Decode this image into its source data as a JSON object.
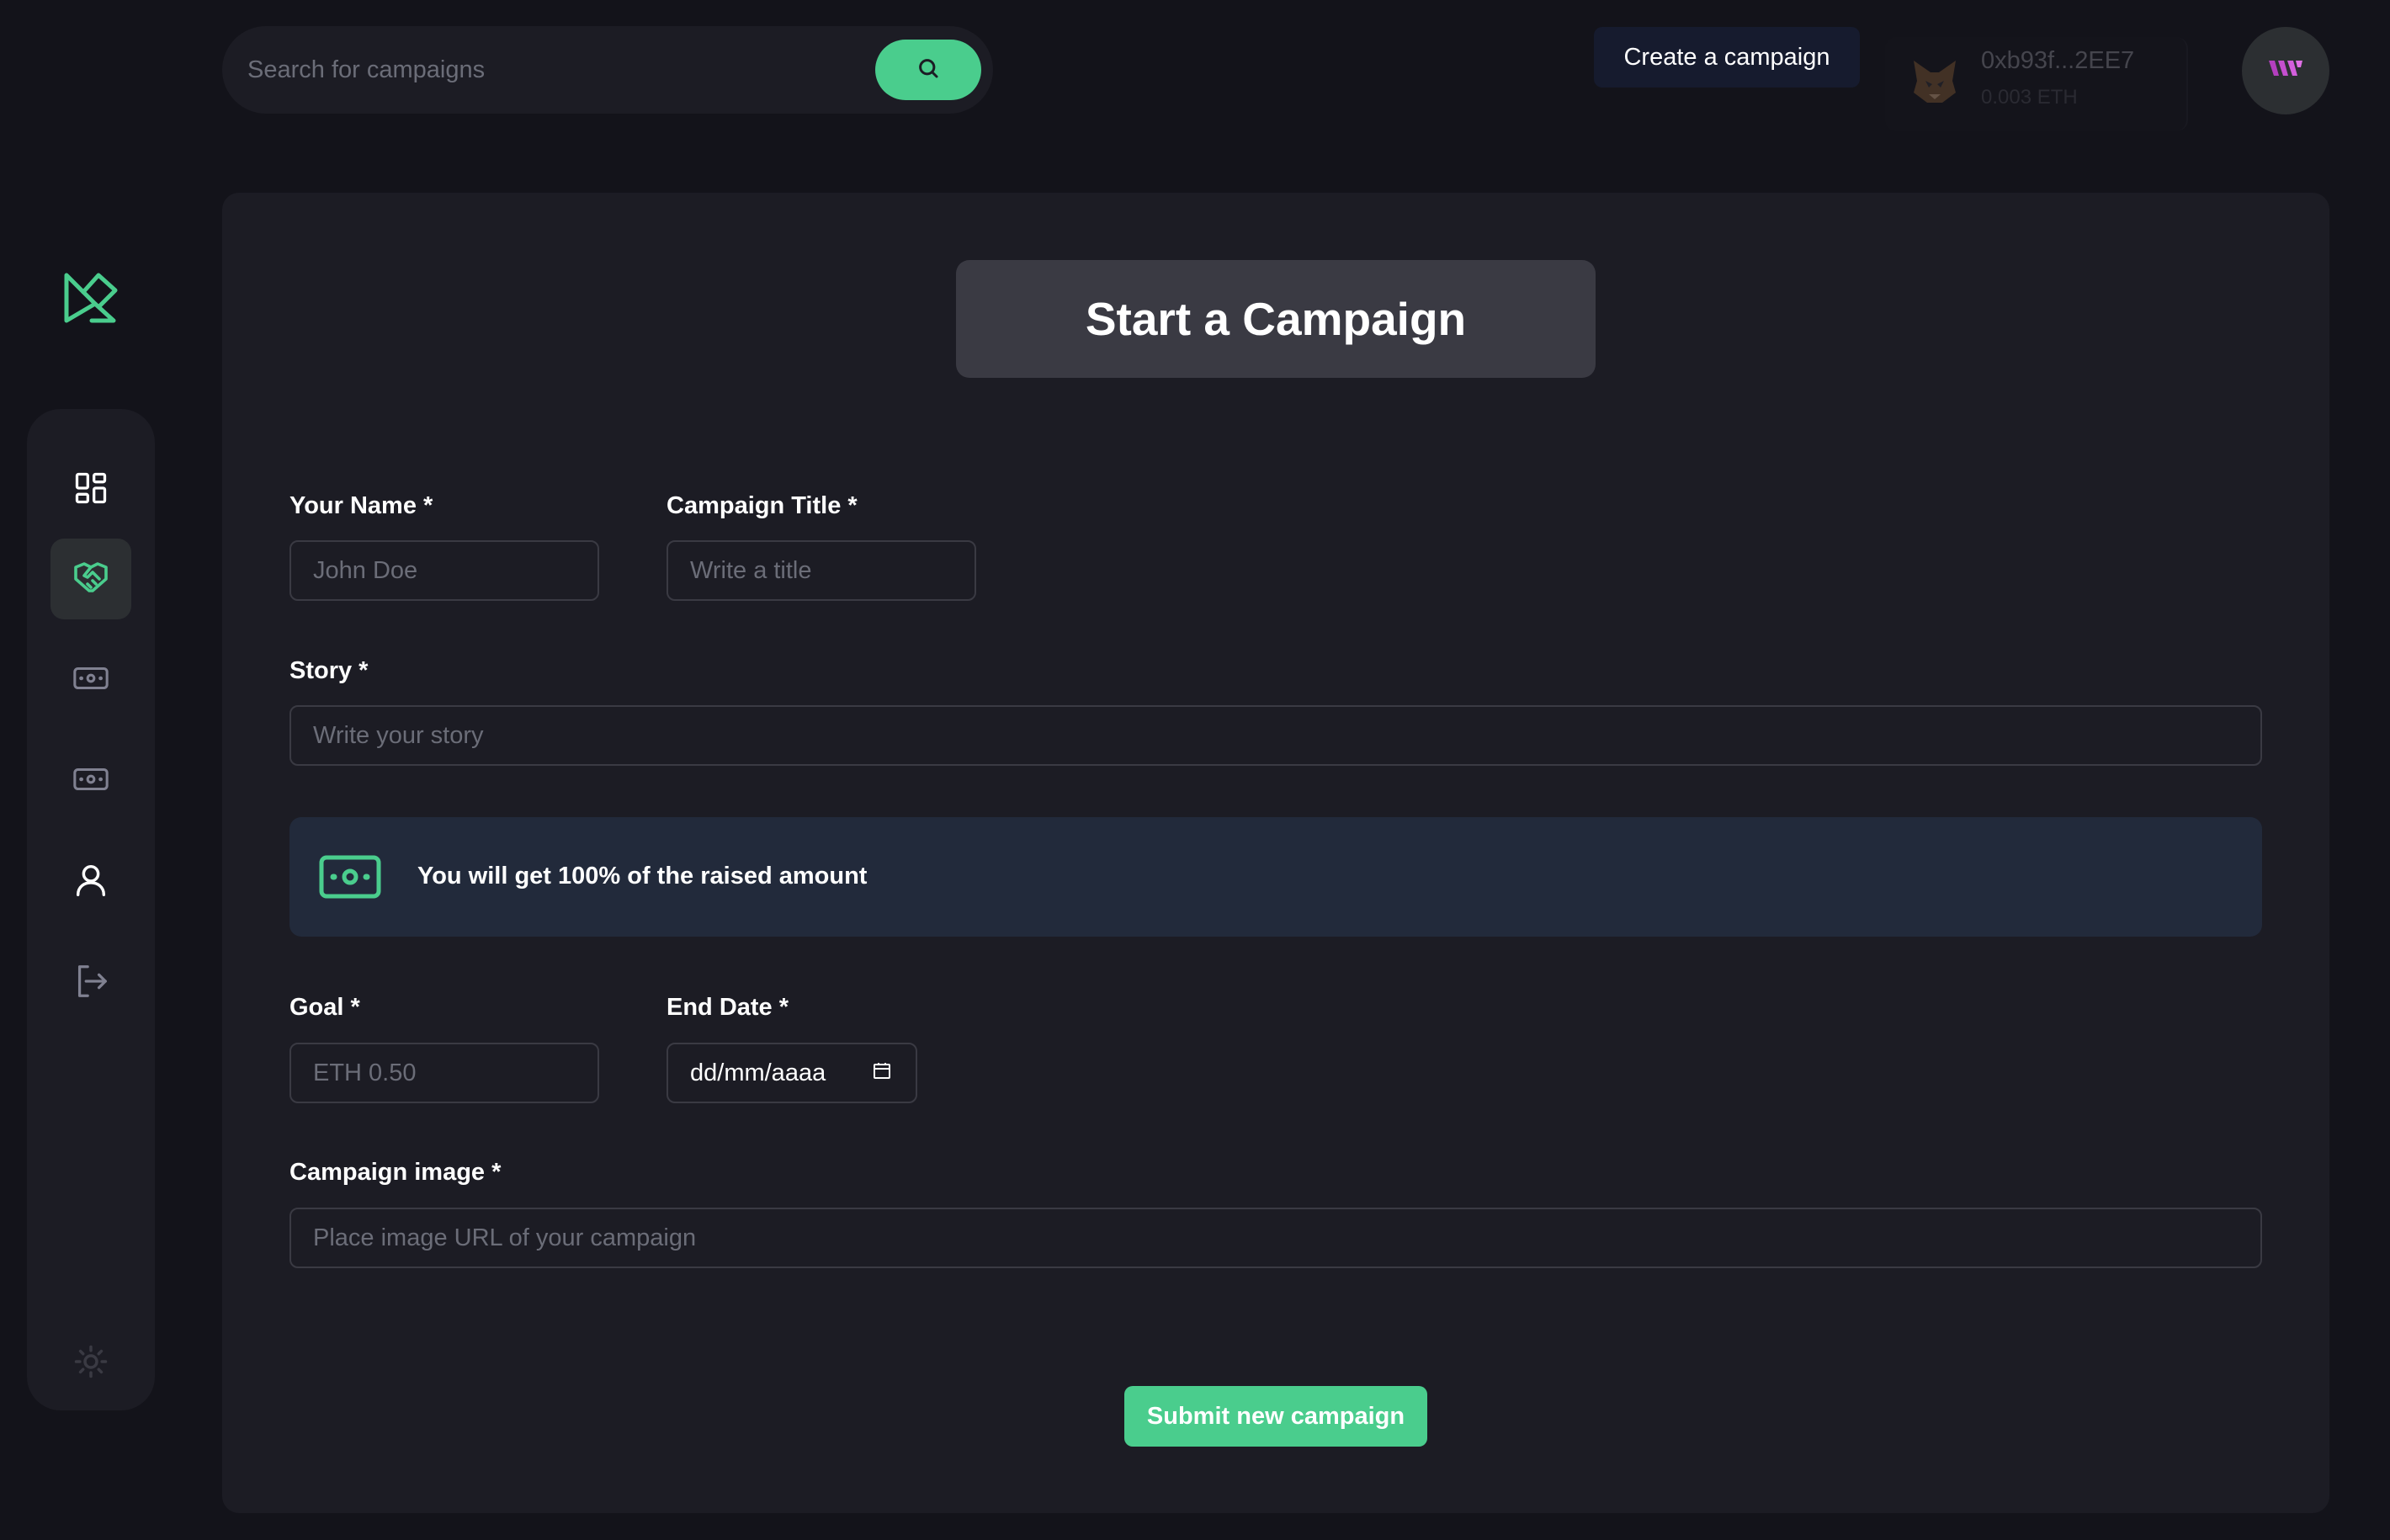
{
  "header": {
    "search_placeholder": "Search for campaigns",
    "create_button": "Create a campaign",
    "wallet_address": "0xb93f...2EE7",
    "wallet_balance": "0.003 ETH"
  },
  "sidebar": {
    "items": [
      {
        "icon": "dashboard-icon",
        "active": false
      },
      {
        "icon": "handshake-icon",
        "active": true
      },
      {
        "icon": "money-icon",
        "active": false
      },
      {
        "icon": "money-icon",
        "active": false
      },
      {
        "icon": "user-icon",
        "active": false
      },
      {
        "icon": "logout-icon",
        "active": false
      }
    ],
    "theme_icon": "sun-icon"
  },
  "form": {
    "title": "Start a Campaign",
    "name_label": "Your Name *",
    "name_placeholder": "John Doe",
    "title_label": "Campaign Title *",
    "title_placeholder": "Write a title",
    "story_label": "Story *",
    "story_placeholder": "Write your story",
    "banner_text": "You will get 100% of the raised amount",
    "goal_label": "Goal *",
    "goal_placeholder": "ETH 0.50",
    "date_label": "End Date *",
    "date_value": "dd/mm/aaaa",
    "image_label": "Campaign image *",
    "image_placeholder": "Place image URL of your campaign",
    "submit_label": "Submit new campaign"
  },
  "colors": {
    "background": "#13131a",
    "panel": "#1c1c24",
    "accent": "#4acd8d",
    "banner": "#222a3b",
    "avatar_logo": "#b43fbf"
  }
}
